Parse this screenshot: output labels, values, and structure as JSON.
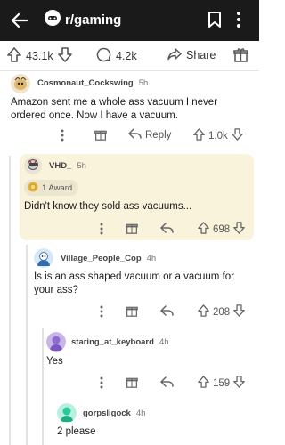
{
  "header": {
    "subreddit": "r/gaming"
  },
  "post_bar": {
    "upvotes": "43.1k",
    "comments": "4.2k",
    "share_label": "Share"
  },
  "comments": [
    {
      "username": "Cosmonaut_Cockswing",
      "age": "5h",
      "body": "Amazon sent me a whole ass vacuum I never ordered once. Now I have a vacuum.",
      "reply_label": "Reply",
      "score": "1.0k"
    },
    {
      "username": "VHD_",
      "age": "5h",
      "award": "1 Award",
      "body": "Didn't know they sold ass vacuums...",
      "score": "698"
    },
    {
      "username": "Village_People_Cop",
      "age": "4h",
      "body": "Is is an ass shaped vacuum or a vacuum for your ass?",
      "score": "208"
    },
    {
      "username": "staring_at_keyboard",
      "age": "4h",
      "body": "Yes",
      "score": "159"
    },
    {
      "username": "gorpsligock",
      "age": "4h",
      "body": "2 please"
    }
  ],
  "colors": {
    "topbar": "#1a1a1b",
    "highlight": "#faf3dc",
    "accent": "#ff4500"
  }
}
